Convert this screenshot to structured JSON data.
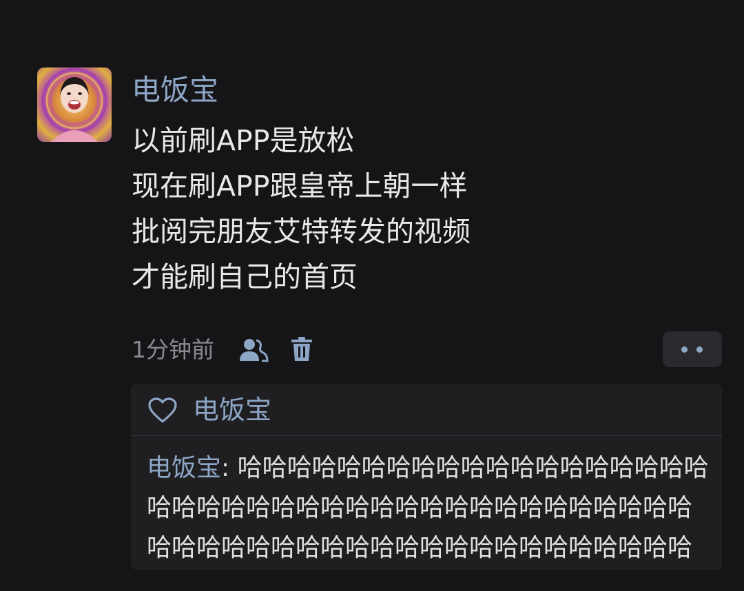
{
  "post": {
    "username": "电饭宝",
    "lines": [
      "以前刷APP是放松",
      "现在刷APP跟皇帝上朝一样",
      "批阅完朋友艾特转发的视频",
      "才能刷自己的首页"
    ],
    "timestamp": "1分钟前"
  },
  "actions": {
    "visibility_icon": "people-icon",
    "delete_icon": "trash-icon",
    "more_icon": "more-dots-icon"
  },
  "likes": {
    "icon": "heart-outline-icon",
    "names": "电饭宝"
  },
  "reply": {
    "author": "电饭宝",
    "separator": ": ",
    "text": "哈哈哈哈哈哈哈哈哈哈哈哈哈哈哈哈哈哈哈哈哈哈哈哈哈哈哈哈哈哈哈哈哈哈哈哈哈哈哈哈哈哈哈哈哈哈哈哈哈哈哈哈哈哈哈哈哈哈哈哈哈哈哈哈哈哈哈哈哈哈哈哈哈哈哈哈哈哈哈哈"
  },
  "colors": {
    "background": "#151417",
    "name_blue": "#8ea6c6",
    "panel": "#1f1f22",
    "muted": "#8a8a8e"
  }
}
